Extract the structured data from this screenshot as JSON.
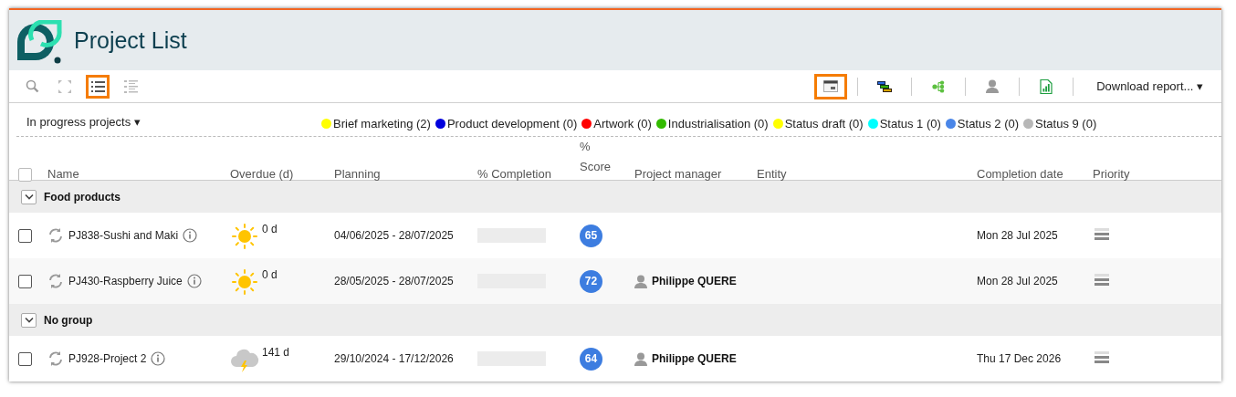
{
  "header": {
    "title": "Project List"
  },
  "toolbar": {
    "left_buttons": [
      {
        "kind": "search",
        "selected": false
      },
      {
        "kind": "expand",
        "selected": false
      },
      {
        "kind": "list",
        "selected": true
      },
      {
        "kind": "detail_list",
        "selected": false
      }
    ],
    "right_buttons": [
      {
        "kind": "calendar",
        "selected": true
      },
      {
        "kind": "gantt",
        "selected": false
      },
      {
        "kind": "tree",
        "selected": false
      },
      {
        "kind": "person",
        "selected": false
      },
      {
        "kind": "spreadsheet",
        "selected": false
      }
    ],
    "download": "Download report... ▾"
  },
  "filter": {
    "label": "In progress projects ▾"
  },
  "legend": [
    {
      "label": "Brief marketing (2)",
      "color": "#ffff00"
    },
    {
      "label": "Product development (0)",
      "color": "#0000dd"
    },
    {
      "label": "Artwork (0)",
      "color": "#ff0000"
    },
    {
      "label": "Industrialisation (0)",
      "color": "#33bb00"
    },
    {
      "label": "Status draft (0)",
      "color": "#ffff00"
    },
    {
      "label": "Status 1 (0)",
      "color": "#00ffff"
    },
    {
      "label": "Status 2 (0)",
      "color": "#4a86e8"
    },
    {
      "label": "Status 9 (0)",
      "color": "#b7b7b7"
    }
  ],
  "table": {
    "select_all": {
      "checked": false
    },
    "columns": [
      "Name",
      "Overdue (d)",
      "Planning",
      "% Completion",
      "% Score",
      "Project manager",
      "Entity",
      "Completion date",
      "Priority"
    ],
    "groups": [
      {
        "label": "Food products",
        "expanded": true,
        "rows": [
          {
            "checked": false,
            "name": "PJ838-Sushi and Maki",
            "overdue_icon": {
              "kind": "sun"
            },
            "overdue": "0 d",
            "planning": "04/06/2025 - 28/07/2025",
            "completion": {
              "level": 0
            },
            "score": "65",
            "completion_date": "Mon 28 Jul 2025"
          },
          {
            "checked": false,
            "name": "PJ430-Raspberry Juice",
            "overdue_icon": {
              "kind": "sun"
            },
            "overdue": "0 d",
            "planning": "28/05/2025 - 28/07/2025",
            "completion": {
              "level": 0
            },
            "score": "72",
            "manager": "Philippe QUERE",
            "completion_date": "Mon 28 Jul 2025"
          }
        ]
      },
      {
        "label": "No group",
        "expanded": true,
        "rows": [
          {
            "checked": false,
            "name": "PJ928-Project 2",
            "overdue_icon": {
              "kind": "storm"
            },
            "overdue": "141 d",
            "planning": "29/10/2024 - 17/12/2026",
            "completion": {
              "level": 0
            },
            "score": "64",
            "manager": "Philippe QUERE",
            "completion_date": "Thu 17 Dec 2026"
          }
        ]
      }
    ]
  }
}
